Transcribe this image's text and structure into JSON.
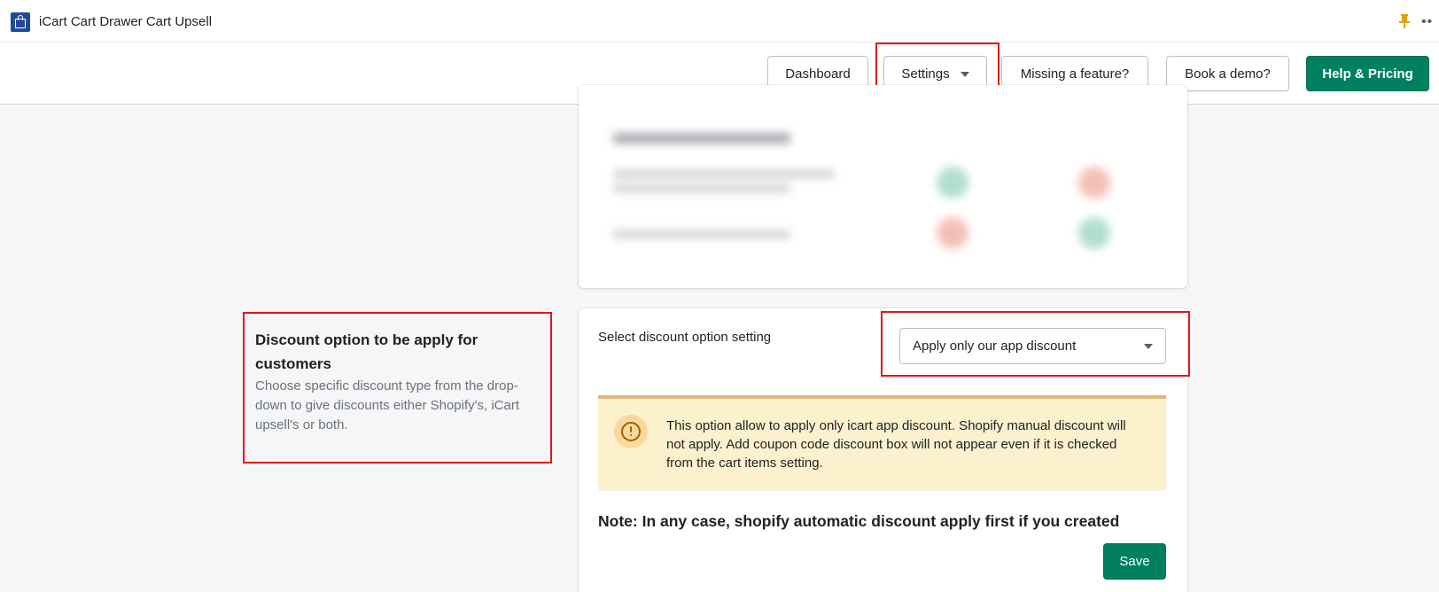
{
  "app": {
    "title": "iCart Cart Drawer Cart Upsell",
    "logo_icon": "shopping-bag-icon",
    "pin_icon": "pin-icon",
    "more_icon": "more-horizontal-icon",
    "more_glyph": "••"
  },
  "nav": {
    "buttons": [
      {
        "label": "Dashboard"
      },
      {
        "label": "Settings",
        "has_dropdown": true
      },
      {
        "label": "Missing a feature?"
      },
      {
        "label": "Book a demo?"
      },
      {
        "label": "Help & Pricing",
        "primary": true
      }
    ]
  },
  "discount_section": {
    "title": "Discount option to be apply for customers",
    "description": "Choose specific discount type from the drop-down to give discounts either Shopify's, iCart upsell's or both.",
    "select_label": "Select discount option setting",
    "selected_option": "Apply only our app discount",
    "banner_text": "This option allow to apply only icart app discount. Shopify manual discount will not apply. Add coupon code discount box will not appear even if it is checked from the cart items setting.",
    "note": "Note: In any case, shopify automatic discount apply first if you created",
    "save_label": "Save"
  },
  "colors": {
    "primary": "#008060",
    "warning_bg": "#fcf1cd",
    "highlight": "#e3141a",
    "logo_blue": "#1f4b99",
    "pin": "#e0a100"
  }
}
